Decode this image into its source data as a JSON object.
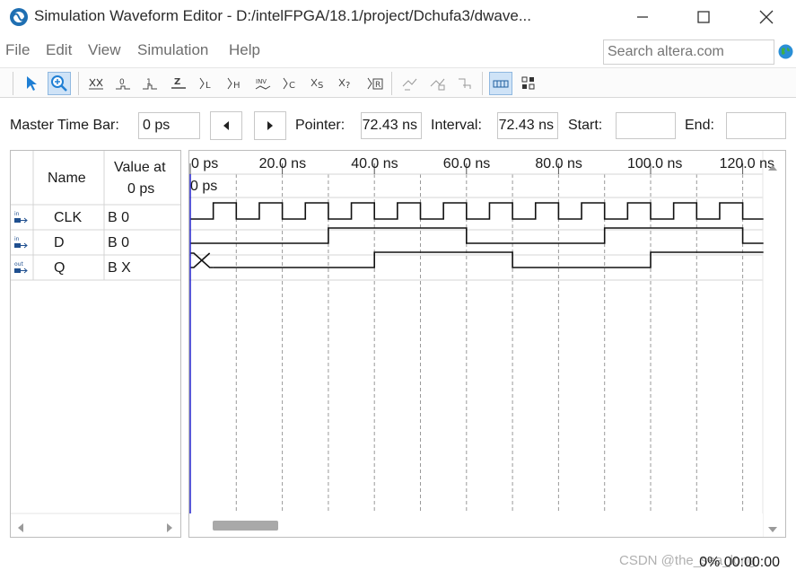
{
  "window": {
    "title": "Simulation Waveform Editor - D:/intelFPGA/18.1/project/Dchufa3/dwave..."
  },
  "menu": {
    "items": [
      "File",
      "Edit",
      "View",
      "Simulation",
      "Help"
    ]
  },
  "search": {
    "placeholder": "Search altera.com"
  },
  "toolbar": {
    "icons": [
      "selection-tool-icon",
      "zoom-tool-icon",
      "force-unknown-icon",
      "force-low-icon",
      "force-high-icon",
      "force-hiz-icon",
      "force-weak-low-icon",
      "force-weak-high-icon",
      "invert-icon",
      "count-value-icon",
      "forcing-clock-icon",
      "random-value-icon",
      "arbitrary-value-icon",
      "snap-to-grid-icon",
      "function-simulation-icon",
      "timing-simulation-icon",
      "waveform-snap-icon",
      "grid-toggle-icon"
    ]
  },
  "timebar": {
    "master_label": "Master Time Bar:",
    "master_value": "0 ps",
    "pointer_label": "Pointer:",
    "pointer_value": "72.43 ns",
    "interval_label": "Interval:",
    "interval_value": "72.43 ns",
    "start_label": "Start:",
    "start_value": "",
    "end_label": "End:",
    "end_value": ""
  },
  "table": {
    "name_header": "Name",
    "value_header_line1": "Value at",
    "value_header_line2": "0 ps",
    "signals": [
      {
        "dir": "in",
        "name": "CLK",
        "value": "B 0"
      },
      {
        "dir": "in",
        "name": "D",
        "value": "B 0"
      },
      {
        "dir": "out",
        "name": "Q",
        "value": "B X"
      }
    ]
  },
  "timeline": {
    "ticks": [
      "0 ps",
      "20.0 ns",
      "40.0 ns",
      "60.0 ns",
      "80.0 ns",
      "100.0 ns",
      "120.0 ns"
    ],
    "cursor_label": "0 ps"
  },
  "waveforms": {
    "clk_period_ns": 10,
    "d_transitions_ns": [
      30,
      60,
      90,
      120
    ],
    "q_unknown_until_ns": 5,
    "q_transitions_ns": [
      40,
      70,
      100
    ]
  },
  "status": {
    "text": "0%   00:00:00",
    "watermark": "CSDN @the_sea_long"
  }
}
